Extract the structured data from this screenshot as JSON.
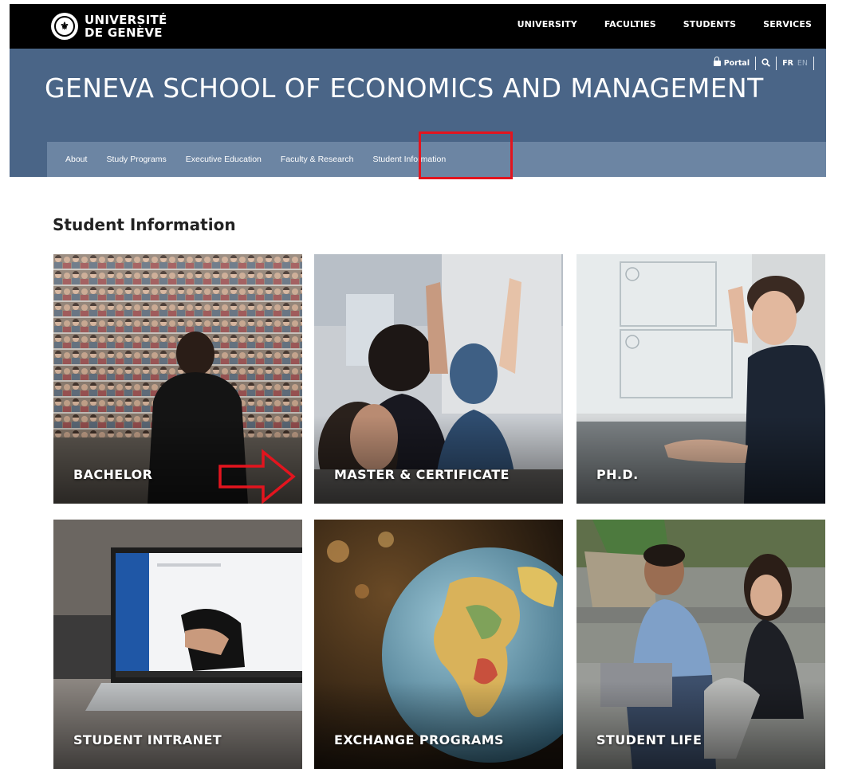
{
  "logo": {
    "line1": "UNIVERSITÉ",
    "line2": "DE GENÈVE"
  },
  "topnav": [
    "UNIVERSITY",
    "FACULTIES",
    "STUDENTS",
    "SERVICES"
  ],
  "utility": {
    "portal": "Portal",
    "lang_active": "FR",
    "lang_inactive": "EN"
  },
  "site_title": "GENEVA SCHOOL OF ECONOMICS AND MANAGEMENT",
  "subnav": [
    "About",
    "Study Programs",
    "Executive Education",
    "Faculty & Research",
    "Student Information"
  ],
  "section_title": "Student Information",
  "tiles": [
    "BACHELOR",
    "MASTER & CERTIFICATE",
    "PH.D.",
    "STUDENT INTRANET",
    "EXCHANGE PROGRAMS",
    "STUDENT LIFE"
  ],
  "colors": {
    "header_bg": "#4a6587",
    "subnav_bg": "#6c85a3",
    "annotation_red": "#e3141e"
  }
}
